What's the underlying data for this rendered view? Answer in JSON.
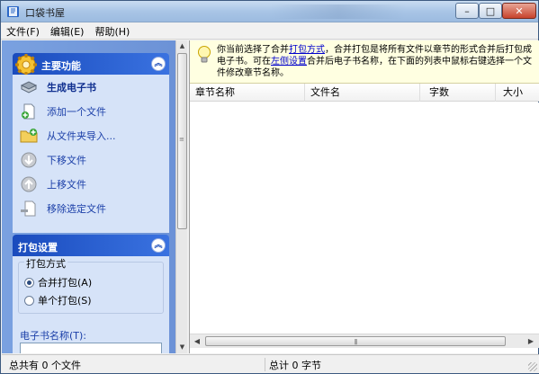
{
  "window": {
    "title": "口袋书屋",
    "controls": {
      "minimize": "–",
      "maximize": "□",
      "close": "✕"
    }
  },
  "menu": [
    "文件(F)",
    "编辑(E)",
    "帮助(H)"
  ],
  "main_functions": {
    "header": "主要功能",
    "collapse_glyph": "︽",
    "tasks": [
      {
        "label": "生成电子书",
        "icon": "book-stack-icon"
      },
      {
        "label": "添加一个文件",
        "icon": "add-file-icon"
      },
      {
        "label": "从文件夹导入...",
        "icon": "folder-import-icon"
      },
      {
        "label": "下移文件",
        "icon": "move-down-icon"
      },
      {
        "label": "上移文件",
        "icon": "move-up-icon"
      },
      {
        "label": "移除选定文件",
        "icon": "remove-file-icon"
      }
    ]
  },
  "pack_settings": {
    "header": "打包设置",
    "collapse_glyph": "︽",
    "method_legend": "打包方式",
    "options": [
      {
        "label": "合并打包(A)",
        "selected": true
      },
      {
        "label": "单个打包(S)",
        "selected": false
      }
    ],
    "name_label": "电子书名称(T):",
    "name_value": ""
  },
  "info": {
    "part1": "你当前选择了合并",
    "link1": "打包方式",
    "part2": "，合并打包是将所有文件以章节的形式合并后打包成电子书。可在",
    "link2": "左侧设置",
    "part3": "合并后电子书名称，在下面的列表中鼠标右键选择一个文件修改章节名称。"
  },
  "table": {
    "columns": [
      "章节名称",
      "文件名",
      "字数",
      "大小"
    ],
    "rows": []
  },
  "status": {
    "left": "总共有 0 个文件",
    "right": "总计 0 字节"
  }
}
